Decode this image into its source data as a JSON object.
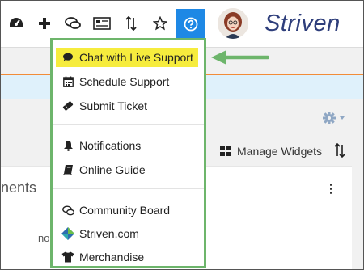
{
  "brand": {
    "name": "Striven"
  },
  "toolbar": {
    "icons": [
      "dashboard-icon",
      "plus-icon",
      "chat-icon",
      "newspaper-icon",
      "sort-icon",
      "star-icon",
      "help-icon"
    ],
    "help_color": "#1e88e5"
  },
  "content": {
    "manage_widgets_label": "Manage Widgets",
    "panel_title": "nents",
    "partial_text": "no"
  },
  "help_menu": {
    "border_color": "#6db56b",
    "highlight_color": "#f6ec3d",
    "items": [
      {
        "label": "Chat with Live Support",
        "icon": "chat-bubble-icon",
        "highlighted": true
      },
      {
        "label": "Schedule Support",
        "icon": "calendar-icon"
      },
      {
        "label": "Submit Ticket",
        "icon": "ticket-icon"
      },
      {
        "label": "Notifications",
        "icon": "bell-icon"
      },
      {
        "label": "Online Guide",
        "icon": "book-icon"
      },
      {
        "label": "Community Board",
        "icon": "comments-icon"
      },
      {
        "label": "Striven.com",
        "icon": "striven-logo-icon"
      },
      {
        "label": "Merchandise",
        "icon": "tshirt-icon"
      }
    ]
  },
  "callout": {
    "arrow_color": "#6db56b"
  }
}
